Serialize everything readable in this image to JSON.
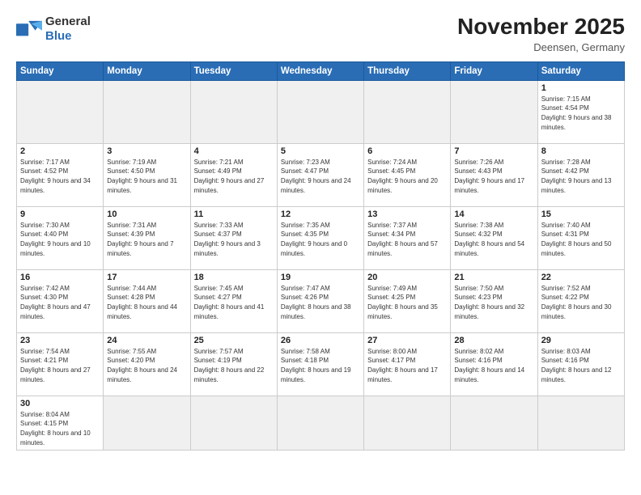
{
  "header": {
    "logo_general": "General",
    "logo_blue": "Blue",
    "month_title": "November 2025",
    "location": "Deensen, Germany"
  },
  "weekdays": [
    "Sunday",
    "Monday",
    "Tuesday",
    "Wednesday",
    "Thursday",
    "Friday",
    "Saturday"
  ],
  "weeks": [
    [
      {
        "day": "",
        "empty": true
      },
      {
        "day": "",
        "empty": true
      },
      {
        "day": "",
        "empty": true
      },
      {
        "day": "",
        "empty": true
      },
      {
        "day": "",
        "empty": true
      },
      {
        "day": "",
        "empty": true
      },
      {
        "day": "1",
        "sunrise": "7:15 AM",
        "sunset": "4:54 PM",
        "daylight": "9 hours and 38 minutes."
      }
    ],
    [
      {
        "day": "2",
        "sunrise": "7:17 AM",
        "sunset": "4:52 PM",
        "daylight": "9 hours and 34 minutes."
      },
      {
        "day": "3",
        "sunrise": "7:19 AM",
        "sunset": "4:50 PM",
        "daylight": "9 hours and 31 minutes."
      },
      {
        "day": "4",
        "sunrise": "7:21 AM",
        "sunset": "4:49 PM",
        "daylight": "9 hours and 27 minutes."
      },
      {
        "day": "5",
        "sunrise": "7:23 AM",
        "sunset": "4:47 PM",
        "daylight": "9 hours and 24 minutes."
      },
      {
        "day": "6",
        "sunrise": "7:24 AM",
        "sunset": "4:45 PM",
        "daylight": "9 hours and 20 minutes."
      },
      {
        "day": "7",
        "sunrise": "7:26 AM",
        "sunset": "4:43 PM",
        "daylight": "9 hours and 17 minutes."
      },
      {
        "day": "8",
        "sunrise": "7:28 AM",
        "sunset": "4:42 PM",
        "daylight": "9 hours and 13 minutes."
      }
    ],
    [
      {
        "day": "9",
        "sunrise": "7:30 AM",
        "sunset": "4:40 PM",
        "daylight": "9 hours and 10 minutes."
      },
      {
        "day": "10",
        "sunrise": "7:31 AM",
        "sunset": "4:39 PM",
        "daylight": "9 hours and 7 minutes."
      },
      {
        "day": "11",
        "sunrise": "7:33 AM",
        "sunset": "4:37 PM",
        "daylight": "9 hours and 3 minutes."
      },
      {
        "day": "12",
        "sunrise": "7:35 AM",
        "sunset": "4:35 PM",
        "daylight": "9 hours and 0 minutes."
      },
      {
        "day": "13",
        "sunrise": "7:37 AM",
        "sunset": "4:34 PM",
        "daylight": "8 hours and 57 minutes."
      },
      {
        "day": "14",
        "sunrise": "7:38 AM",
        "sunset": "4:32 PM",
        "daylight": "8 hours and 54 minutes."
      },
      {
        "day": "15",
        "sunrise": "7:40 AM",
        "sunset": "4:31 PM",
        "daylight": "8 hours and 50 minutes."
      }
    ],
    [
      {
        "day": "16",
        "sunrise": "7:42 AM",
        "sunset": "4:30 PM",
        "daylight": "8 hours and 47 minutes."
      },
      {
        "day": "17",
        "sunrise": "7:44 AM",
        "sunset": "4:28 PM",
        "daylight": "8 hours and 44 minutes."
      },
      {
        "day": "18",
        "sunrise": "7:45 AM",
        "sunset": "4:27 PM",
        "daylight": "8 hours and 41 minutes."
      },
      {
        "day": "19",
        "sunrise": "7:47 AM",
        "sunset": "4:26 PM",
        "daylight": "8 hours and 38 minutes."
      },
      {
        "day": "20",
        "sunrise": "7:49 AM",
        "sunset": "4:25 PM",
        "daylight": "8 hours and 35 minutes."
      },
      {
        "day": "21",
        "sunrise": "7:50 AM",
        "sunset": "4:23 PM",
        "daylight": "8 hours and 32 minutes."
      },
      {
        "day": "22",
        "sunrise": "7:52 AM",
        "sunset": "4:22 PM",
        "daylight": "8 hours and 30 minutes."
      }
    ],
    [
      {
        "day": "23",
        "sunrise": "7:54 AM",
        "sunset": "4:21 PM",
        "daylight": "8 hours and 27 minutes."
      },
      {
        "day": "24",
        "sunrise": "7:55 AM",
        "sunset": "4:20 PM",
        "daylight": "8 hours and 24 minutes."
      },
      {
        "day": "25",
        "sunrise": "7:57 AM",
        "sunset": "4:19 PM",
        "daylight": "8 hours and 22 minutes."
      },
      {
        "day": "26",
        "sunrise": "7:58 AM",
        "sunset": "4:18 PM",
        "daylight": "8 hours and 19 minutes."
      },
      {
        "day": "27",
        "sunrise": "8:00 AM",
        "sunset": "4:17 PM",
        "daylight": "8 hours and 17 minutes."
      },
      {
        "day": "28",
        "sunrise": "8:02 AM",
        "sunset": "4:16 PM",
        "daylight": "8 hours and 14 minutes."
      },
      {
        "day": "29",
        "sunrise": "8:03 AM",
        "sunset": "4:16 PM",
        "daylight": "8 hours and 12 minutes."
      }
    ],
    [
      {
        "day": "30",
        "sunrise": "8:04 AM",
        "sunset": "4:15 PM",
        "daylight": "8 hours and 10 minutes.",
        "lastrow": true
      },
      {
        "day": "",
        "empty": true,
        "lastrow": true
      },
      {
        "day": "",
        "empty": true,
        "lastrow": true
      },
      {
        "day": "",
        "empty": true,
        "lastrow": true
      },
      {
        "day": "",
        "empty": true,
        "lastrow": true
      },
      {
        "day": "",
        "empty": true,
        "lastrow": true
      },
      {
        "day": "",
        "empty": true,
        "lastrow": true
      }
    ]
  ]
}
